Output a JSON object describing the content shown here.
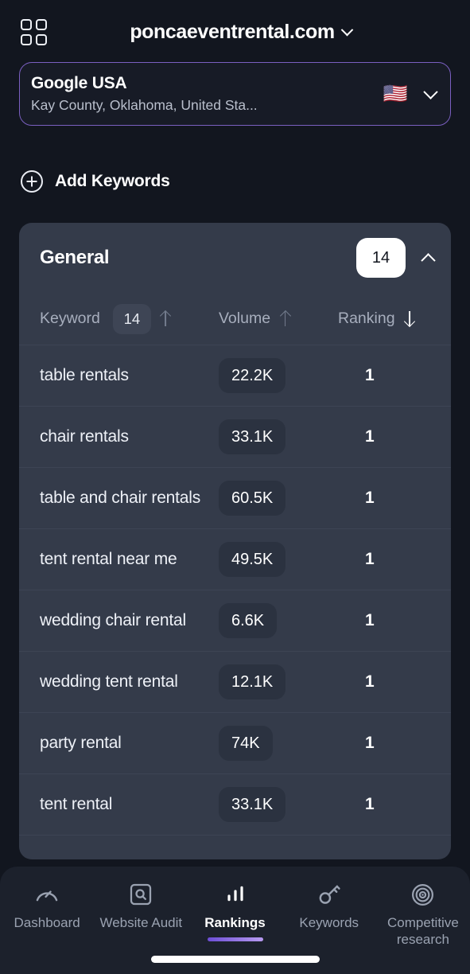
{
  "header": {
    "grid_icon": "apps-grid-icon",
    "site": "poncaeventrental.com",
    "site_chevron": "chevron-down-icon"
  },
  "location_card": {
    "title": "Google USA",
    "subtitle": "Kay County, Oklahoma, United Sta...",
    "flag": "🇺🇸",
    "chevron": "chevron-down-icon",
    "border_color": "#7a5fc0"
  },
  "add_keywords": {
    "icon": "plus-circle-icon",
    "label": "Add Keywords"
  },
  "group_card": {
    "title": "General",
    "count": "14",
    "collapse_icon": "chevron-up-icon",
    "table": {
      "columns": {
        "keyword": "Keyword",
        "keyword_count": "14",
        "keyword_sort": "arrow-up-icon",
        "volume": "Volume",
        "volume_sort": "arrow-up-icon",
        "ranking": "Ranking",
        "ranking_sort": "arrow-down-icon"
      },
      "rows": [
        {
          "keyword": "table rentals",
          "volume": "22.2K",
          "ranking": "1"
        },
        {
          "keyword": "chair rentals",
          "volume": "33.1K",
          "ranking": "1"
        },
        {
          "keyword": "table and chair rentals",
          "volume": "60.5K",
          "ranking": "1"
        },
        {
          "keyword": "tent rental near me",
          "volume": "49.5K",
          "ranking": "1"
        },
        {
          "keyword": "wedding chair rental",
          "volume": "6.6K",
          "ranking": "1"
        },
        {
          "keyword": "wedding tent rental",
          "volume": "12.1K",
          "ranking": "1"
        },
        {
          "keyword": "party rental",
          "volume": "74K",
          "ranking": "1"
        },
        {
          "keyword": "tent rental",
          "volume": "33.1K",
          "ranking": "1"
        }
      ]
    }
  },
  "bottom_nav": {
    "active": "Rankings",
    "accent_color": "#8b6ae4",
    "items": [
      {
        "label": "Dashboard",
        "icon": "gauge-icon"
      },
      {
        "label": "Website Audit",
        "icon": "search-box-icon"
      },
      {
        "label": "Rankings",
        "icon": "bar-chart-icon"
      },
      {
        "label": "Keywords",
        "icon": "key-icon"
      },
      {
        "label": "Competitive research",
        "icon": "target-icon"
      }
    ]
  }
}
